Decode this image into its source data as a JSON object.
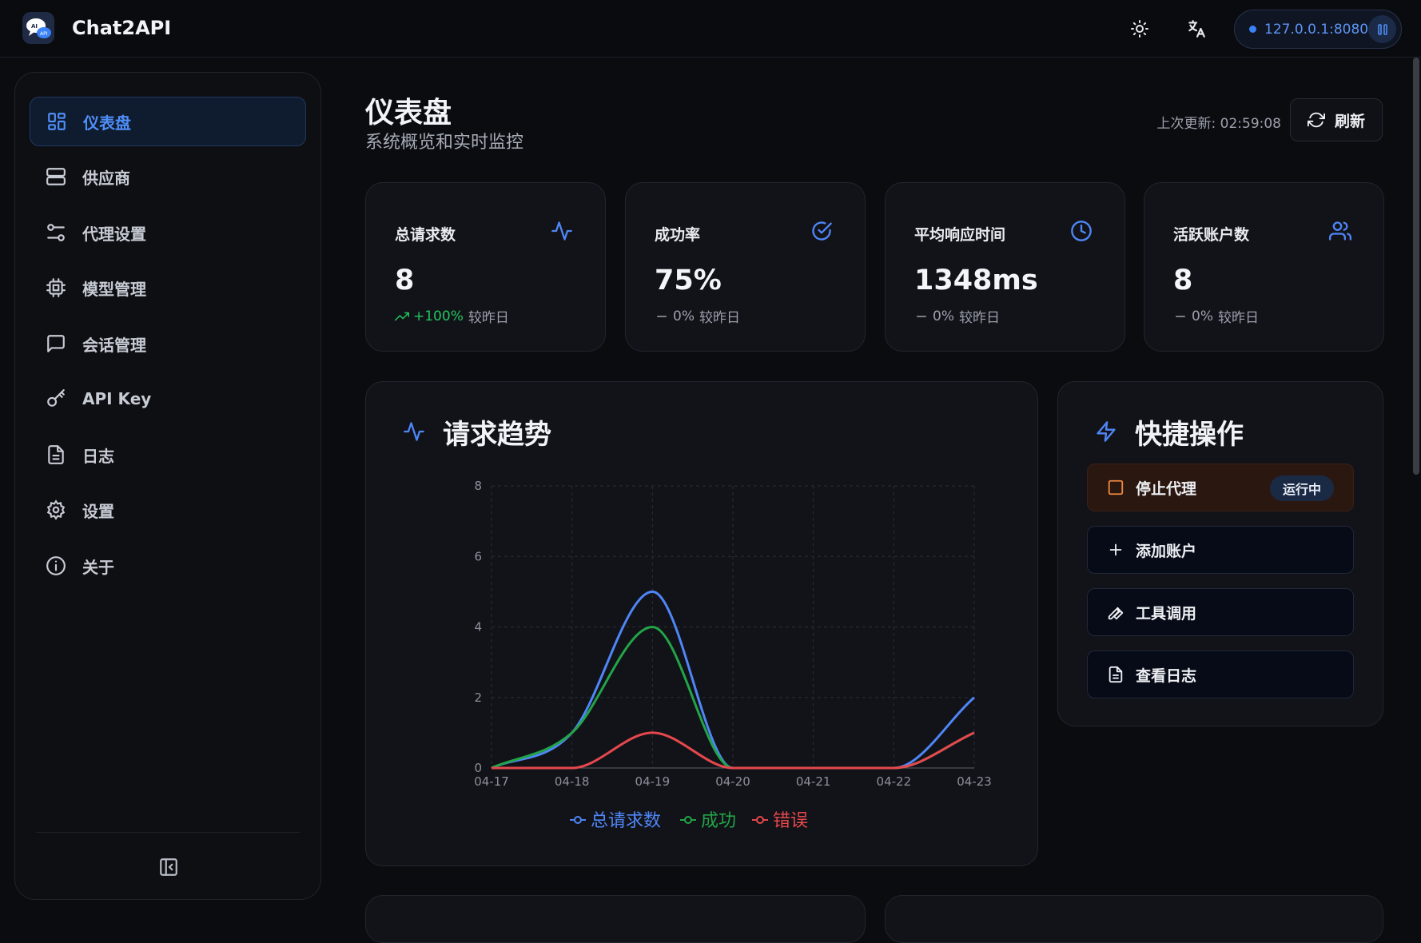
{
  "app": {
    "title": "Chat2API",
    "server_address": "127.0.0.1:8080",
    "accent_color": "#3b82f6"
  },
  "header": {
    "icons": [
      "sun-icon",
      "translate-icon",
      "pause-icon"
    ]
  },
  "sidebar": {
    "items": [
      {
        "label": "仪表盘",
        "icon": "dashboard-grid-icon",
        "active": true
      },
      {
        "label": "供应商",
        "icon": "server-icon",
        "active": false
      },
      {
        "label": "代理设置",
        "icon": "sliders-icon",
        "active": false
      },
      {
        "label": "模型管理",
        "icon": "cpu-chip-icon",
        "active": false
      },
      {
        "label": "会话管理",
        "icon": "message-square-icon",
        "active": false
      },
      {
        "label": "API Key",
        "icon": "key-icon",
        "active": false
      },
      {
        "label": "日志",
        "icon": "file-text-icon",
        "active": false
      },
      {
        "label": "设置",
        "icon": "gear-icon",
        "active": false
      },
      {
        "label": "关于",
        "icon": "info-icon",
        "active": false
      }
    ]
  },
  "page": {
    "title": "仪表盘",
    "subtitle": "系统概览和实时监控",
    "last_update": "上次更新: 02:59:08",
    "refresh_label": "刷新"
  },
  "stats": [
    {
      "title": "总请求数",
      "value": "8",
      "delta": "+100%",
      "delta_suffix": "较昨日",
      "trend": "up",
      "icon": "activity-icon"
    },
    {
      "title": "成功率",
      "value": "75%",
      "delta": "0%",
      "delta_suffix": "较昨日",
      "trend": "flat",
      "icon": "check-circle-icon"
    },
    {
      "title": "平均响应时间",
      "value": "1348ms",
      "delta": "0%",
      "delta_suffix": "较昨日",
      "trend": "flat",
      "icon": "clock-icon"
    },
    {
      "title": "活跃账户数",
      "value": "8",
      "delta": "0%",
      "delta_suffix": "较昨日",
      "trend": "flat",
      "icon": "users-icon"
    }
  ],
  "trend_card": {
    "title": "请求趋势"
  },
  "quick_actions": {
    "title": "快捷操作",
    "buttons": [
      {
        "label": "停止代理",
        "icon": "stop-square-icon",
        "badge": "运行中"
      },
      {
        "label": "添加账户",
        "icon": "plus-icon"
      },
      {
        "label": "工具调用",
        "icon": "wrench-icon"
      },
      {
        "label": "查看日志",
        "icon": "file-text-icon"
      }
    ]
  },
  "chart_data": {
    "type": "line",
    "x": [
      "04-17",
      "04-18",
      "04-19",
      "04-20",
      "04-21",
      "04-22",
      "04-23"
    ],
    "series": [
      {
        "name": "总请求数",
        "values": [
          0,
          1,
          5,
          0,
          0,
          0,
          2
        ],
        "color": "#4f86f7"
      },
      {
        "name": "成功",
        "values": [
          0,
          1,
          4,
          0,
          0,
          0,
          1
        ],
        "color": "#22a447"
      },
      {
        "name": "错误",
        "values": [
          0,
          0,
          1,
          0,
          0,
          0,
          1
        ],
        "color": "#e5484d"
      }
    ],
    "y_ticks": [
      0,
      2,
      4,
      6,
      8
    ],
    "ylim": [
      0,
      8
    ],
    "grid": true,
    "legend": "bottom-center"
  }
}
